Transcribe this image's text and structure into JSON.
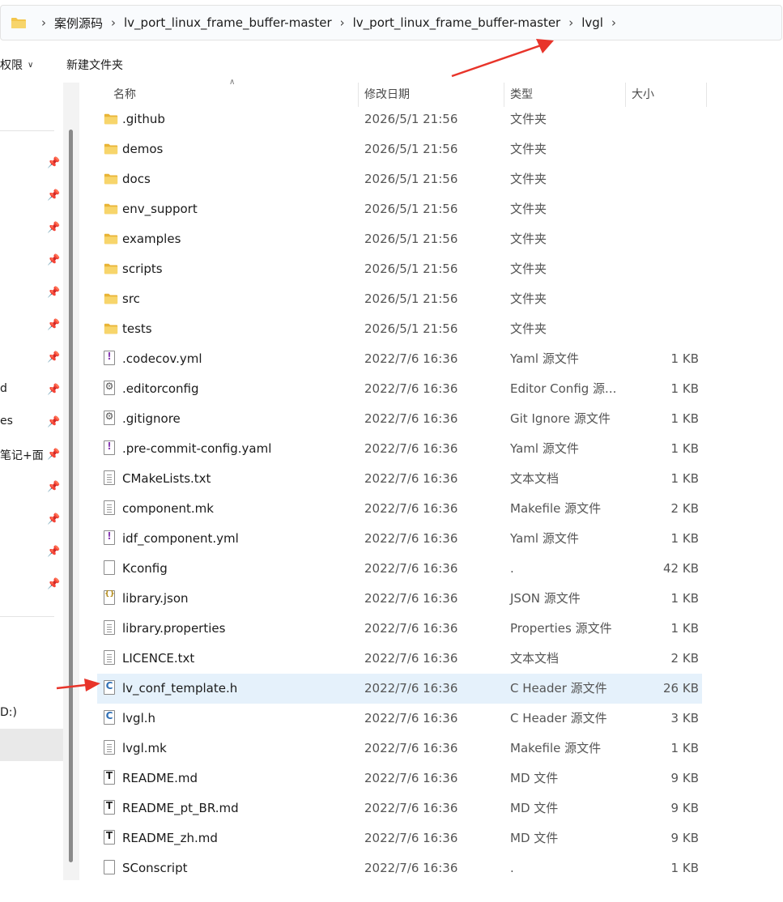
{
  "breadcrumb": {
    "items": [
      "案例源码",
      "lv_port_linux_frame_buffer-master",
      "lv_port_linux_frame_buffer-master",
      "lvgl"
    ],
    "separator": "›"
  },
  "toolbar": {
    "permission_label": "权限",
    "new_folder_label": "新建文件夹"
  },
  "nav": {
    "fragments": [
      "d",
      "es",
      "笔记+面"
    ],
    "drive_fragment": "D:)"
  },
  "columns": {
    "name": "名称",
    "modified": "修改日期",
    "type": "类型",
    "size": "大小"
  },
  "files": [
    {
      "name": ".github",
      "modified": "2026/5/1 21:56",
      "type": "文件夹",
      "size": "",
      "icon": "folder-icon"
    },
    {
      "name": "demos",
      "modified": "2026/5/1 21:56",
      "type": "文件夹",
      "size": "",
      "icon": "folder-icon"
    },
    {
      "name": "docs",
      "modified": "2026/5/1 21:56",
      "type": "文件夹",
      "size": "",
      "icon": "folder-icon"
    },
    {
      "name": "env_support",
      "modified": "2026/5/1 21:56",
      "type": "文件夹",
      "size": "",
      "icon": "folder-icon"
    },
    {
      "name": "examples",
      "modified": "2026/5/1 21:56",
      "type": "文件夹",
      "size": "",
      "icon": "folder-icon"
    },
    {
      "name": "scripts",
      "modified": "2026/5/1 21:56",
      "type": "文件夹",
      "size": "",
      "icon": "folder-icon"
    },
    {
      "name": "src",
      "modified": "2026/5/1 21:56",
      "type": "文件夹",
      "size": "",
      "icon": "folder-icon"
    },
    {
      "name": "tests",
      "modified": "2026/5/1 21:56",
      "type": "文件夹",
      "size": "",
      "icon": "folder-icon"
    },
    {
      "name": ".codecov.yml",
      "modified": "2022/7/6 16:36",
      "type": "Yaml 源文件",
      "size": "1 KB",
      "icon": "yaml-file-icon"
    },
    {
      "name": ".editorconfig",
      "modified": "2022/7/6 16:36",
      "type": "Editor Config 源...",
      "size": "1 KB",
      "icon": "config-file-icon"
    },
    {
      "name": ".gitignore",
      "modified": "2022/7/6 16:36",
      "type": "Git Ignore 源文件",
      "size": "1 KB",
      "icon": "config-file-icon"
    },
    {
      "name": ".pre-commit-config.yaml",
      "modified": "2022/7/6 16:36",
      "type": "Yaml 源文件",
      "size": "1 KB",
      "icon": "yaml-file-icon"
    },
    {
      "name": "CMakeLists.txt",
      "modified": "2022/7/6 16:36",
      "type": "文本文档",
      "size": "1 KB",
      "icon": "text-file-icon"
    },
    {
      "name": "component.mk",
      "modified": "2022/7/6 16:36",
      "type": "Makefile 源文件",
      "size": "2 KB",
      "icon": "text-file-icon"
    },
    {
      "name": "idf_component.yml",
      "modified": "2022/7/6 16:36",
      "type": "Yaml 源文件",
      "size": "1 KB",
      "icon": "yaml-file-icon"
    },
    {
      "name": "Kconfig",
      "modified": "2022/7/6 16:36",
      "type": ".",
      "size": "42 KB",
      "icon": "blank-file-icon"
    },
    {
      "name": "library.json",
      "modified": "2022/7/6 16:36",
      "type": "JSON 源文件",
      "size": "1 KB",
      "icon": "json-file-icon"
    },
    {
      "name": "library.properties",
      "modified": "2022/7/6 16:36",
      "type": "Properties 源文件",
      "size": "1 KB",
      "icon": "text-file-icon"
    },
    {
      "name": "LICENCE.txt",
      "modified": "2022/7/6 16:36",
      "type": "文本文档",
      "size": "2 KB",
      "icon": "text-file-icon"
    },
    {
      "name": "lv_conf_template.h",
      "modified": "2022/7/6 16:36",
      "type": "C Header 源文件",
      "size": "26 KB",
      "icon": "c-header-file-icon",
      "selected": true
    },
    {
      "name": "lvgl.h",
      "modified": "2022/7/6 16:36",
      "type": "C Header 源文件",
      "size": "3 KB",
      "icon": "c-header-file-icon"
    },
    {
      "name": "lvgl.mk",
      "modified": "2022/7/6 16:36",
      "type": "Makefile 源文件",
      "size": "1 KB",
      "icon": "text-file-icon"
    },
    {
      "name": "README.md",
      "modified": "2022/7/6 16:36",
      "type": "MD 文件",
      "size": "9 KB",
      "icon": "markdown-file-icon"
    },
    {
      "name": "README_pt_BR.md",
      "modified": "2022/7/6 16:36",
      "type": "MD 文件",
      "size": "9 KB",
      "icon": "markdown-file-icon"
    },
    {
      "name": "README_zh.md",
      "modified": "2022/7/6 16:36",
      "type": "MD 文件",
      "size": "9 KB",
      "icon": "markdown-file-icon"
    },
    {
      "name": "SConscript",
      "modified": "2022/7/6 16:36",
      "type": ".",
      "size": "1 KB",
      "icon": "blank-file-icon"
    }
  ],
  "colors": {
    "selected_row": "#e5f1fb",
    "folder": "#f3c64c",
    "annotation_arrow": "#e8342a",
    "c_icon": "#2f6fb5"
  }
}
